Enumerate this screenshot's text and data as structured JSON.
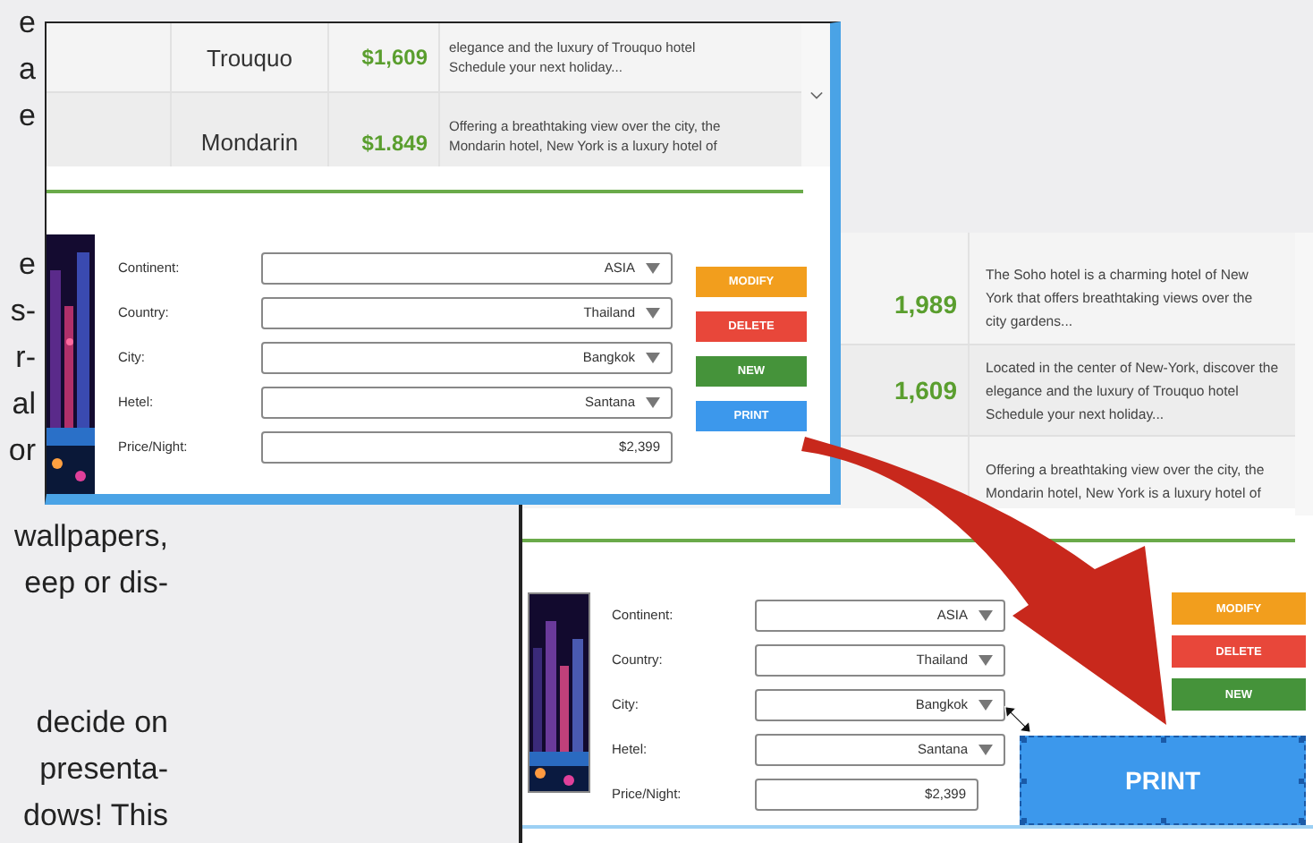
{
  "article": [
    [
      "e",
      "a",
      "e"
    ],
    [
      "e",
      "s-",
      "r-",
      "al",
      "or"
    ],
    [
      "wallpapers,",
      "eep or dis-"
    ],
    [
      "decide on",
      "presenta-",
      "dows! This"
    ]
  ],
  "front_window": {
    "hotels": [
      {
        "name": "Trouquo",
        "price": "$1,609",
        "description": "elegance and the luxury of Trouquo hotel\nSchedule your next holiday..."
      },
      {
        "name": "Mondarin",
        "price": "$1.849",
        "description": "Offering a breathtaking view over the city, the\nMondarin hotel, New York is a luxury hotel of"
      }
    ],
    "fields": [
      {
        "label": "Continent:",
        "value": "ASIA",
        "kind": "dropdown"
      },
      {
        "label": "Country:",
        "value": "Thailand",
        "kind": "dropdown"
      },
      {
        "label": "City:",
        "value": "Bangkok",
        "kind": "dropdown"
      },
      {
        "label": "Hetel:",
        "value": "Santana",
        "kind": "dropdown"
      },
      {
        "label": "Price/Night:",
        "value": "$2,399",
        "kind": "text"
      }
    ],
    "buttons": [
      {
        "label": "MODIFY",
        "color": "#f29e1d"
      },
      {
        "label": "DELETE",
        "color": "#e8473a"
      },
      {
        "label": "NEW",
        "color": "#45933a"
      },
      {
        "label": "PRINT",
        "color": "#3c98ec"
      }
    ]
  },
  "back_window": {
    "hotels": [
      {
        "price": "1,989",
        "description": "The Soho hotel is a charming hotel of New\nYork that offers breathtaking views over the\ncity gardens..."
      },
      {
        "price": "1,609",
        "description": "Located in the center of New-York, discover the\nelegance and the luxury of Trouquo hotel\nSchedule your next holiday..."
      },
      {
        "description": "Offering a breathtaking view over the city, the\nMondarin hotel, New York is a luxury hotel of"
      }
    ],
    "fields": [
      {
        "label": "Continent:",
        "value": "ASIA",
        "kind": "dropdown"
      },
      {
        "label": "Country:",
        "value": "Thailand",
        "kind": "dropdown"
      },
      {
        "label": "City:",
        "value": "Bangkok",
        "kind": "dropdown"
      },
      {
        "label": "Hetel:",
        "value": "Santana",
        "kind": "dropdown"
      },
      {
        "label": "Price/Night:",
        "value": "$2,399",
        "kind": "text"
      }
    ],
    "buttons": [
      {
        "label": "MODIFY",
        "color": "#f29e1d"
      },
      {
        "label": "DELETE",
        "color": "#e8473a"
      },
      {
        "label": "NEW",
        "color": "#45933a"
      }
    ],
    "print_button": {
      "label": "PRINT",
      "selected": true
    }
  }
}
